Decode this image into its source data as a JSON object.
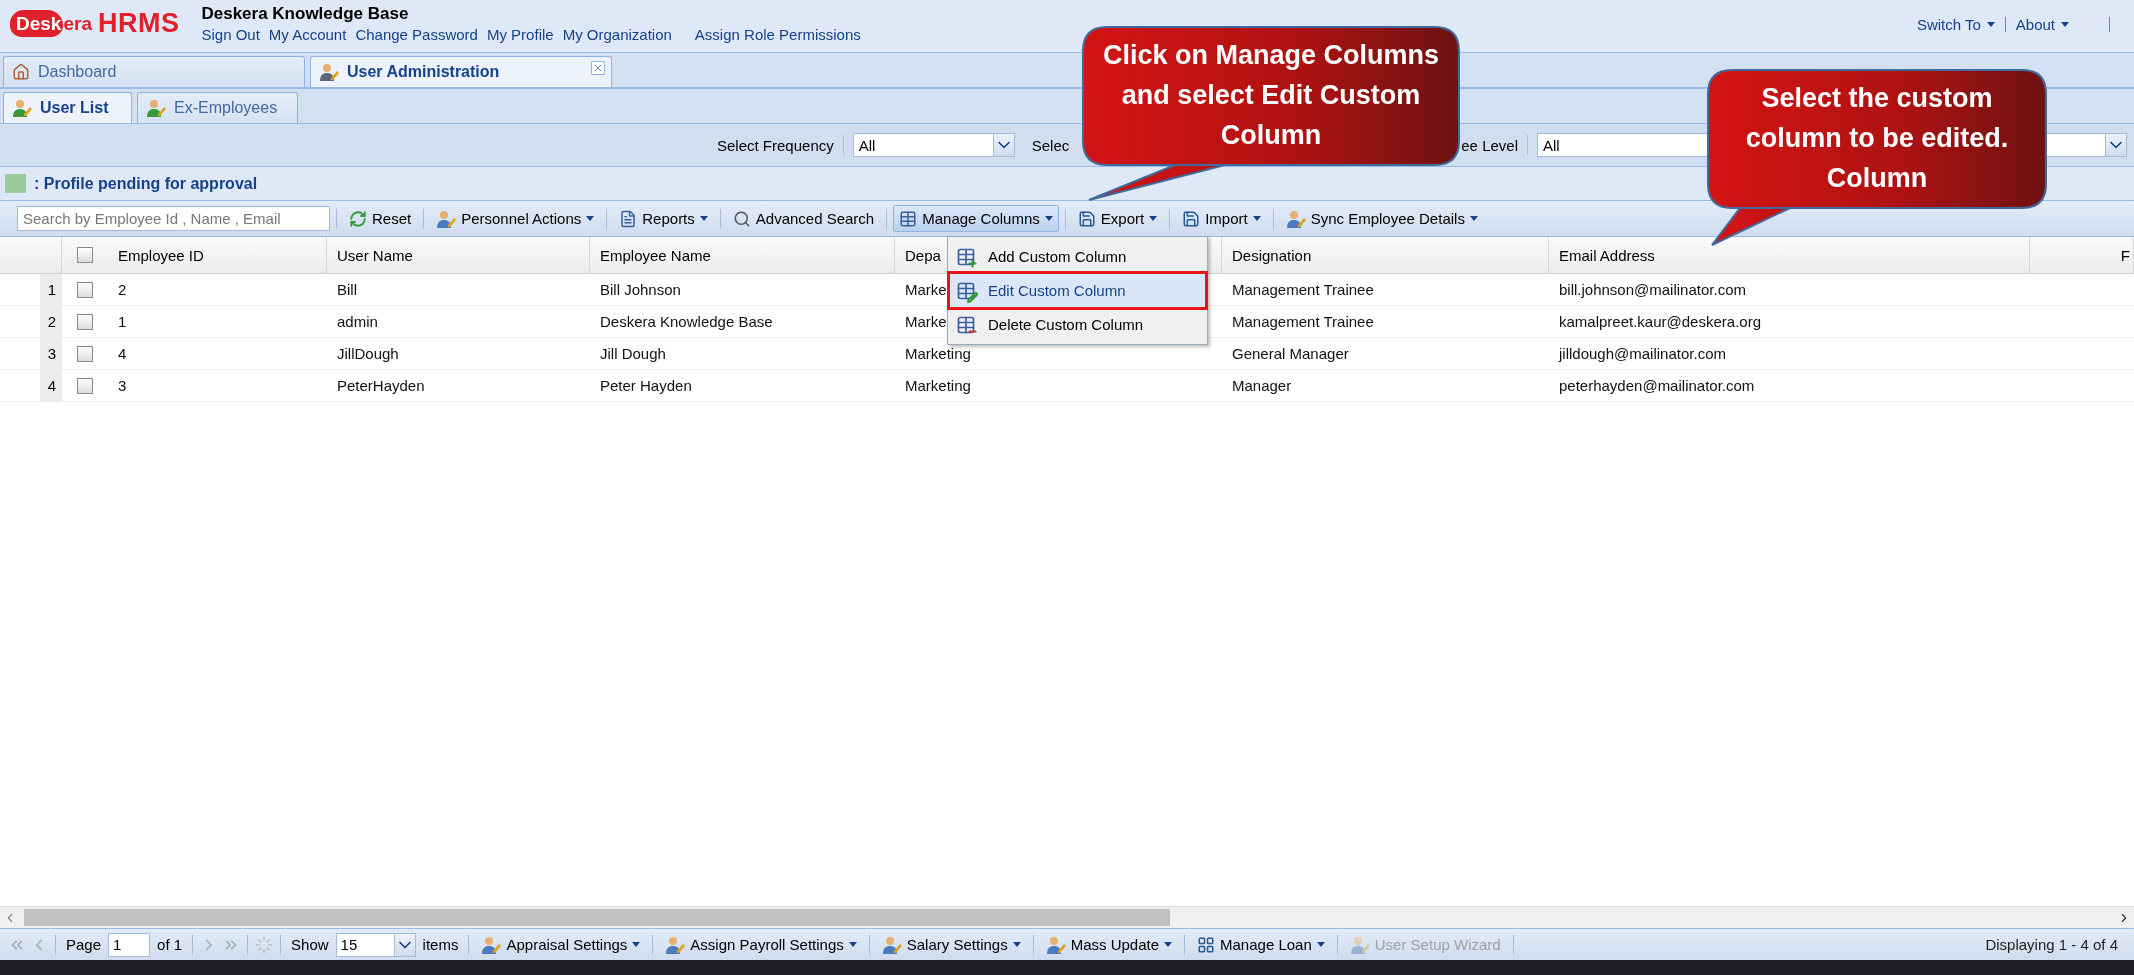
{
  "header": {
    "logo": {
      "mark": "Desk",
      "mark_rest": "era",
      "product": "HRMS"
    },
    "company": "Deskera Knowledge Base",
    "links": [
      "Sign Out",
      "My Account",
      "Change Password",
      "My Profile",
      "My Organization",
      "Assign Role Permissions"
    ],
    "right_menu": [
      "Switch To",
      "About"
    ]
  },
  "main_tabs": [
    {
      "label": "Dashboard",
      "selected": false,
      "closable": false
    },
    {
      "label": "User Administration",
      "selected": true,
      "closable": true
    }
  ],
  "sub_tabs": [
    {
      "label": "User List",
      "selected": true
    },
    {
      "label": "Ex-Employees",
      "selected": false
    }
  ],
  "filters": [
    {
      "label": "Select Frequency",
      "value": "All"
    },
    {
      "label": "Selec"
    },
    {
      "label": "ee Level",
      "value": "All"
    }
  ],
  "legend": ": Profile pending for approval",
  "toolbar": {
    "search": {
      "placeholder": "Search by Employee Id , Name , Email"
    },
    "buttons": [
      {
        "label": "Reset",
        "dropdown": false,
        "pressed": false
      },
      {
        "label": "Personnel Actions",
        "dropdown": true,
        "pressed": false
      },
      {
        "label": "Reports",
        "dropdown": true,
        "pressed": false
      },
      {
        "label": "Advanced Search",
        "dropdown": false,
        "pressed": false
      },
      {
        "label": "Manage Columns",
        "dropdown": true,
        "pressed": true
      },
      {
        "label": "Export",
        "dropdown": true,
        "pressed": false
      },
      {
        "label": "Import",
        "dropdown": true,
        "pressed": false
      },
      {
        "label": "Sync Employee Details",
        "dropdown": true,
        "pressed": false
      }
    ]
  },
  "table": {
    "all_checked": false,
    "columns": [
      "Employee ID",
      "User Name",
      "Employee Name",
      "Depa",
      "Designation",
      "Email Address",
      "F"
    ],
    "rows": [
      {
        "number": "1",
        "checked": false,
        "cells": [
          "2",
          "Bill",
          "Bill Johnson",
          "Marke",
          "Management Trainee",
          "bill.johnson@mailinator.com"
        ]
      },
      {
        "number": "2",
        "checked": false,
        "cells": [
          "1",
          "admin",
          "Deskera Knowledge Base",
          "Marke",
          "Management Trainee",
          "kamalpreet.kaur@deskera.org"
        ]
      },
      {
        "number": "3",
        "checked": false,
        "cells": [
          "4",
          "JillDough",
          "Jill Dough",
          "Marketing",
          "General Manager",
          "jilldough@mailinator.com"
        ]
      },
      {
        "number": "4",
        "checked": false,
        "cells": [
          "3",
          "PeterHayden",
          "Peter Hayden",
          "Marketing",
          "Manager",
          "peterhayden@mailinator.com"
        ]
      }
    ]
  },
  "menu": [
    {
      "label": "Add Custom Column",
      "selected": false
    },
    {
      "label": "Edit Custom Column",
      "selected": true
    },
    {
      "label": "Delete Custom Column",
      "selected": false
    }
  ],
  "pager": {
    "page_label": "Page",
    "page": "1",
    "of": "of 1",
    "show_label": "Show",
    "show": "15",
    "items_label": "items"
  },
  "bottom_buttons": [
    {
      "label": "Appraisal Settings",
      "dropdown": true,
      "disabled": false
    },
    {
      "label": "Assign Payroll Settings",
      "dropdown": true,
      "disabled": false
    },
    {
      "label": "Salary Settings",
      "dropdown": true,
      "disabled": false
    },
    {
      "label": "Mass Update",
      "dropdown": true,
      "disabled": false
    },
    {
      "label": "Manage Loan",
      "dropdown": true,
      "disabled": false
    },
    {
      "label": "User Setup Wizard",
      "dropdown": false,
      "disabled": true
    }
  ],
  "status": "Displaying 1 - 4 of 4",
  "callouts": [
    {
      "text": "Click on Manage Columns and select Edit Custom Column"
    },
    {
      "text": "Select the custom column to be edited. Column"
    }
  ]
}
